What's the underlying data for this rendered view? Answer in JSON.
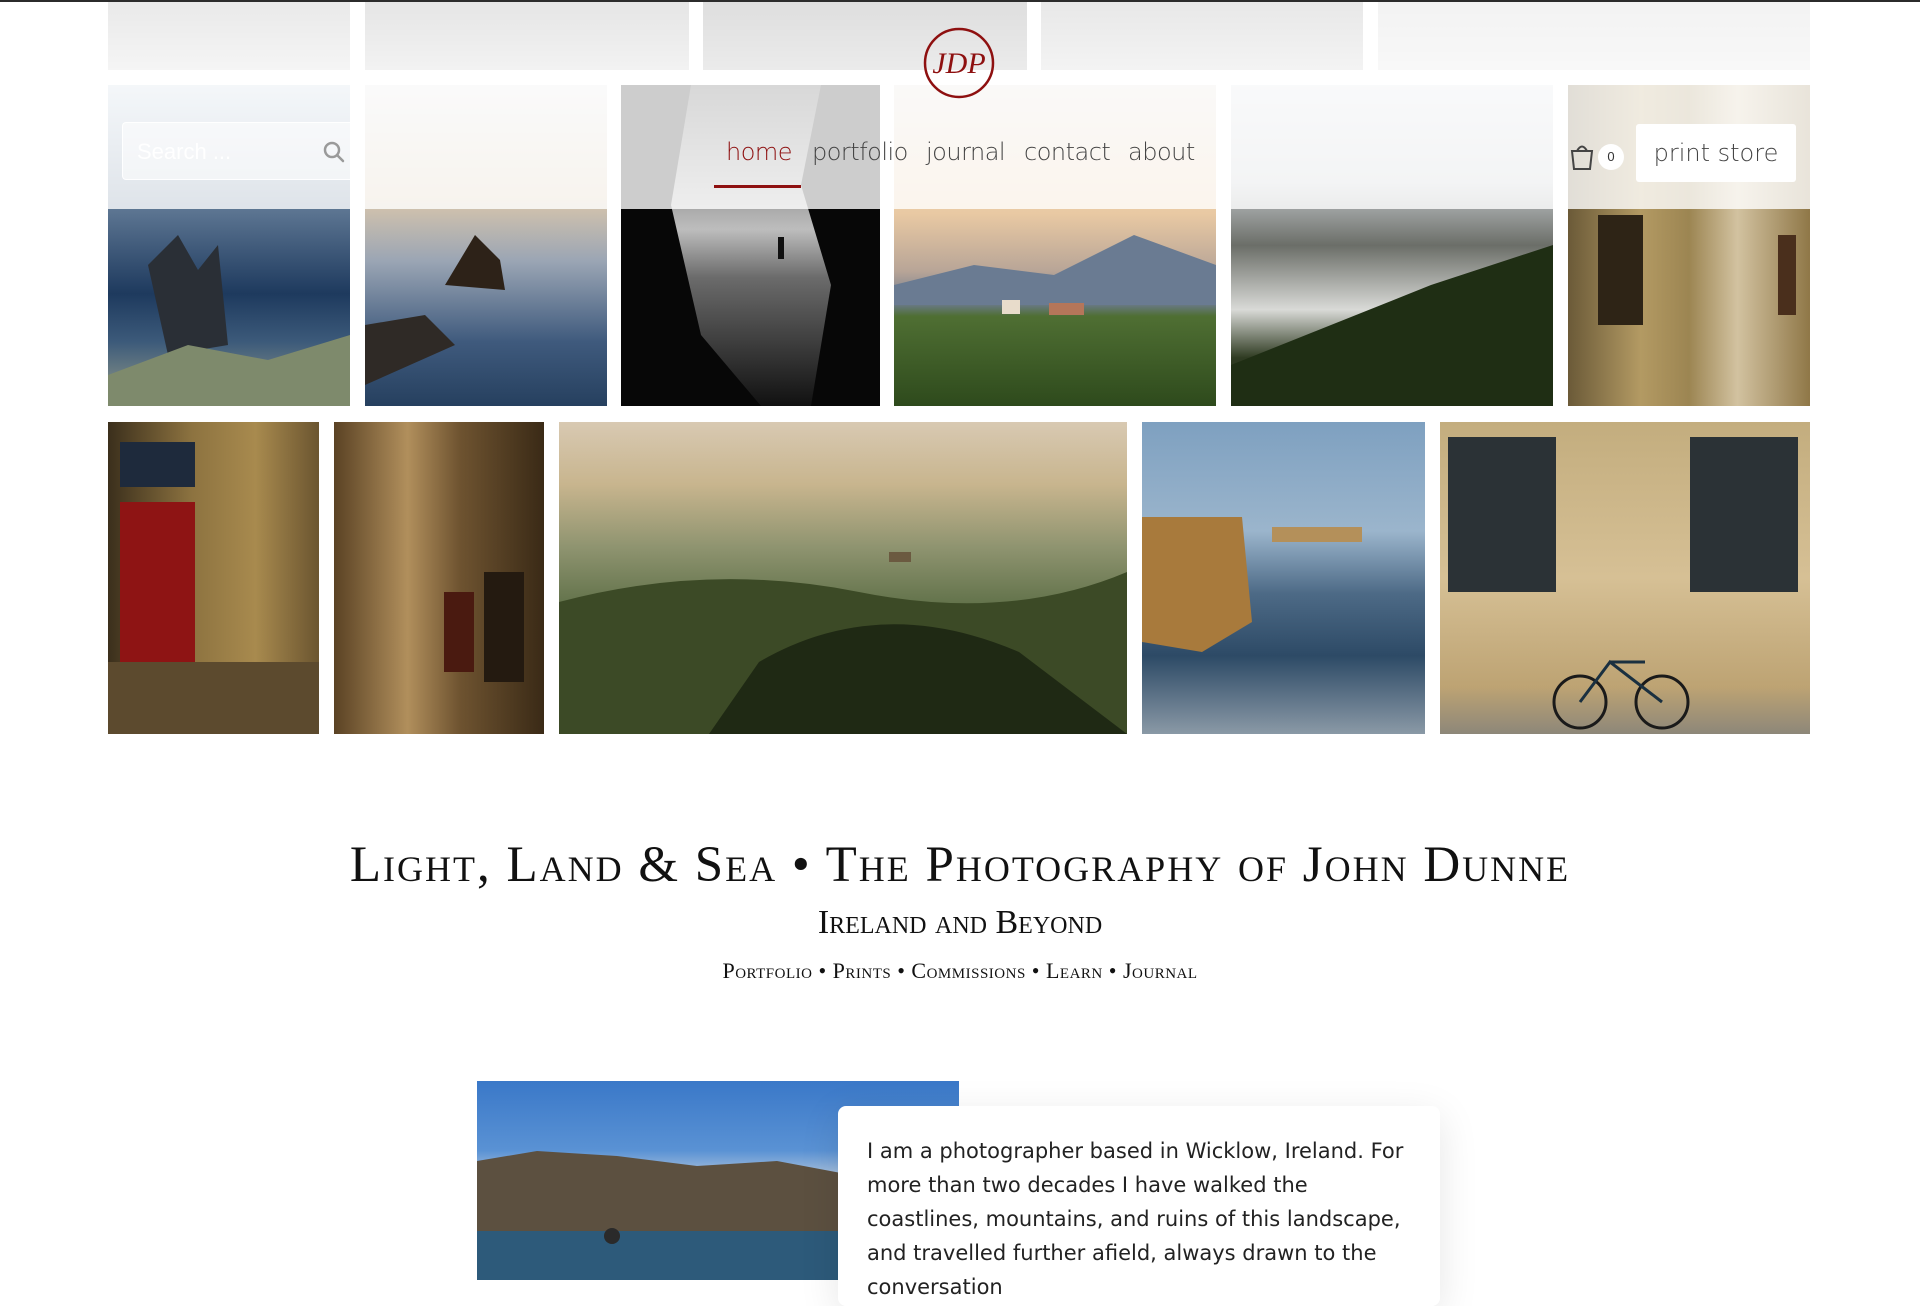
{
  "header": {
    "search": {
      "placeholder": "Search ..."
    },
    "logo_text": "JDP",
    "nav": [
      {
        "label": "home",
        "active": true
      },
      {
        "label": "portfolio",
        "active": false
      },
      {
        "label": "journal",
        "active": false
      },
      {
        "label": "contact",
        "active": false
      },
      {
        "label": "about",
        "active": false
      }
    ],
    "cart_count": "0",
    "print_store_label": "print store"
  },
  "gallery": {
    "row0": [
      "grey-landscape",
      "grey-car-road",
      "grey-landscape",
      "grey-building",
      "grey-sky"
    ],
    "row1": [
      "rock-stack-blue-sea",
      "sea-stack-dusk",
      "black-white-cave",
      "tuscany-chapel",
      "clouds-over-hills",
      "maltese-street"
    ],
    "row2": [
      "red-door",
      "stone-alley",
      "tuscany-rolling-hills",
      "cliffs-crashing-waves",
      "bicycle-by-windows"
    ]
  },
  "hero": {
    "title": "Light, Land & Sea • The Photography of John Dunne",
    "subtitle": "Ireland and Beyond",
    "tagline": "Portfolio • Prints • Commissions • Learn • Journal"
  },
  "intro": {
    "photo": "photographer-on-coast",
    "text": "I am a photographer based in Wicklow, Ireland. For more than two decades I have walked the coastlines, mountains, and ruins of this landscape, and travelled further afield, always drawn to the conversation"
  },
  "colors": {
    "accent": "#8e1010",
    "background": "#ffffff"
  }
}
